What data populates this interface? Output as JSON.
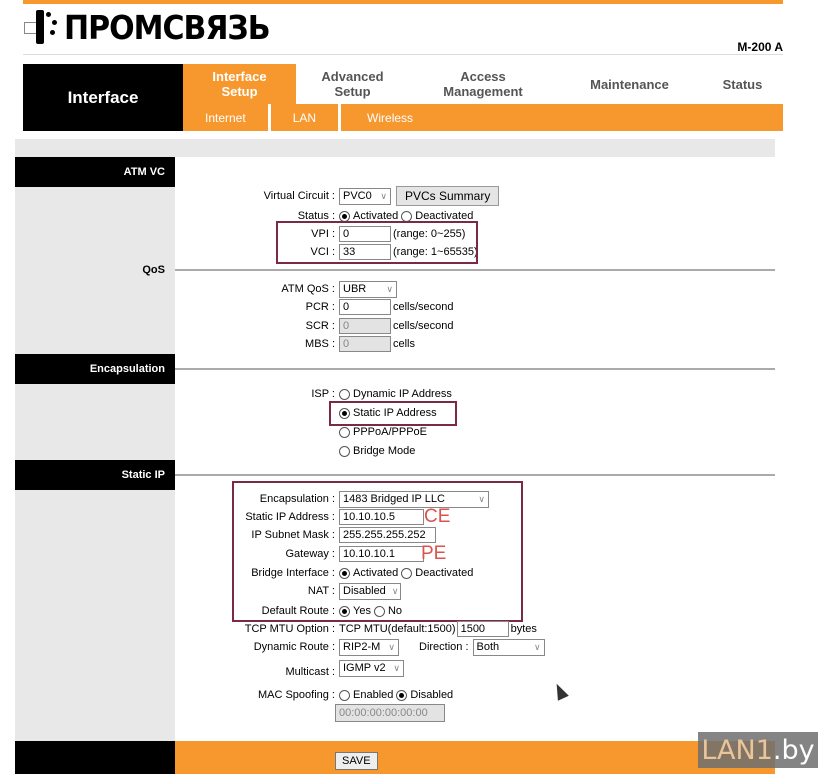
{
  "header": {
    "brand": "ПРОМСВЯЗЬ",
    "model": "M-200 A"
  },
  "nav": {
    "section": "Interface",
    "tabs": [
      {
        "label": "Interface Setup",
        "active": true
      },
      {
        "label": "Advanced Setup",
        "active": false
      },
      {
        "label": "Access Management",
        "active": false
      },
      {
        "label": "Maintenance",
        "active": false
      },
      {
        "label": "Status",
        "active": false
      }
    ],
    "subtabs": [
      {
        "label": "Internet",
        "active": true
      },
      {
        "label": "LAN",
        "active": false
      },
      {
        "label": "Wireless",
        "active": false
      }
    ]
  },
  "sections": {
    "atm_vc": "ATM VC",
    "qos": "QoS",
    "encapsulation": "Encapsulation",
    "static_ip": "Static IP"
  },
  "atm": {
    "virtual_circuit_label": "Virtual Circuit :",
    "virtual_circuit_value": "PVC0",
    "pvcs_summary_button": "PVCs Summary",
    "status_label": "Status :",
    "status_options": [
      "Activated",
      "Deactivated"
    ],
    "status_selected": "Activated",
    "vpi_label": "VPI :",
    "vpi_value": "0",
    "vpi_range": "(range: 0~255)",
    "vci_label": "VCI :",
    "vci_value": "33",
    "vci_range": "(range: 1~65535)"
  },
  "qos": {
    "atm_qos_label": "ATM QoS :",
    "atm_qos_value": "UBR",
    "pcr_label": "PCR :",
    "pcr_value": "0",
    "pcr_unit": "cells/second",
    "scr_label": "SCR :",
    "scr_value": "0",
    "scr_unit": "cells/second",
    "mbs_label": "MBS :",
    "mbs_value": "0",
    "mbs_unit": "cells"
  },
  "isp": {
    "label": "ISP :",
    "options": [
      "Dynamic IP Address",
      "Static IP Address",
      "PPPoA/PPPoE",
      "Bridge Mode"
    ],
    "selected": "Static IP Address"
  },
  "static_ip": {
    "encapsulation_label": "Encapsulation :",
    "encapsulation_value": "1483 Bridged IP LLC",
    "ip_label": "Static IP Address :",
    "ip_value": "10.10.10.5",
    "mask_label": "IP Subnet Mask :",
    "mask_value": "255.255.255.252",
    "gateway_label": "Gateway :",
    "gateway_value": "10.10.10.1",
    "bridge_label": "Bridge Interface :",
    "bridge_options": [
      "Activated",
      "Deactivated"
    ],
    "bridge_selected": "Activated",
    "nat_label": "NAT :",
    "nat_value": "Disabled",
    "default_route_label": "Default Route :",
    "default_route_options": [
      "Yes",
      "No"
    ],
    "default_route_selected": "Yes",
    "tcp_mtu_label": "TCP MTU Option :",
    "tcp_mtu_text": "TCP MTU(default:1500)",
    "tcp_mtu_value": "1500",
    "tcp_mtu_unit": "bytes",
    "dynamic_route_label": "Dynamic Route :",
    "dynamic_route_value": "RIP2-M",
    "direction_label": "Direction :",
    "direction_value": "Both",
    "multicast_label": "Multicast :",
    "multicast_value": "IGMP v2",
    "mac_spoofing_label": "MAC Spoofing :",
    "mac_options": [
      "Enabled",
      "Disabled"
    ],
    "mac_selected": "Disabled",
    "mac_value": "00:00:00:00:00:00"
  },
  "annotations": {
    "ce": "CE",
    "pe": "PE"
  },
  "footer": {
    "save_button": "SAVE"
  },
  "watermark": {
    "main": "LAN1",
    "suffix": ".by"
  },
  "colors": {
    "accent": "#f7982f",
    "highlight_box": "#7a2a45",
    "annotation": "#d9534f"
  }
}
